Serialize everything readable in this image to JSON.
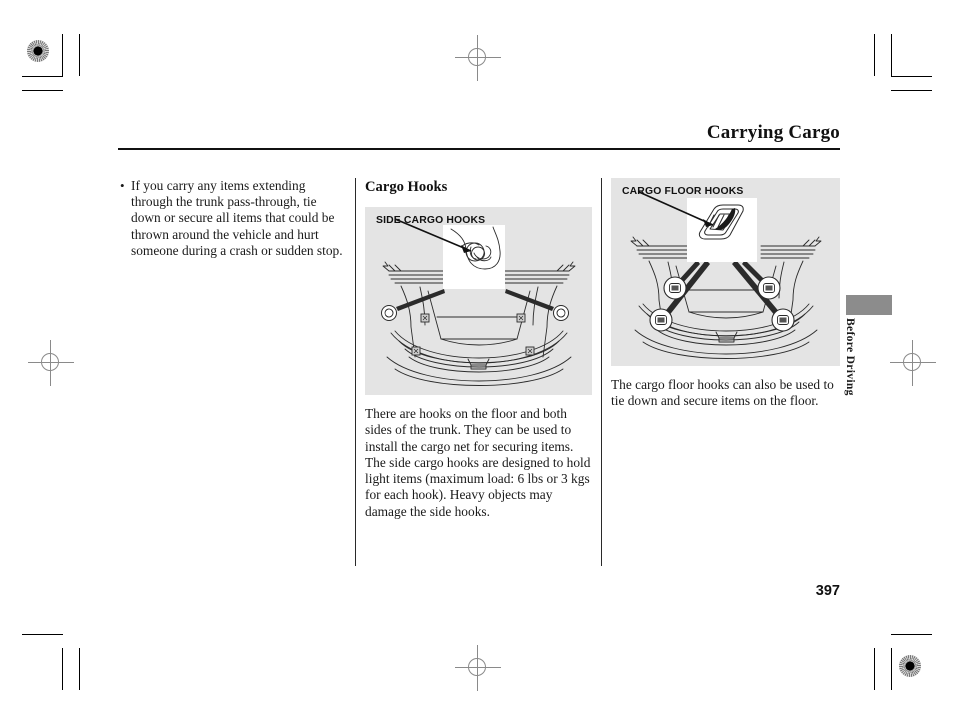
{
  "document": {
    "running_head": "Carrying Cargo",
    "page_number": "397",
    "thumb_tab": "Before Driving"
  },
  "columns": {
    "left": {
      "bullet_marker": "•",
      "bullet_text": "If you carry any items extending through the trunk pass-through, tie down or secure all items that could be thrown around the vehicle and hurt someone during a crash or sudden stop."
    },
    "middle": {
      "section_title": "Cargo Hooks",
      "figure_caption": "SIDE CARGO HOOKS",
      "body_text": "There are hooks on the floor and both sides of the trunk. They can be used to install the cargo net for securing items. The side cargo hooks are designed to hold light items (maximum load: 6 lbs or 3 kgs for each hook). Heavy objects may damage the side hooks."
    },
    "right": {
      "figure_caption": "CARGO FLOOR HOOKS",
      "body_text": "The cargo floor hooks can also be used to tie down and secure items on the floor."
    }
  },
  "figures": {
    "side_cargo_hooks": {
      "name": "trunk-interior-side-hooks-diagram",
      "description": "Rear view of an open trunk showing hook locations on both side walls, with a magnified inset of a single side cargo hook",
      "callout_count": 2,
      "floor_marker_count": 4
    },
    "cargo_floor_hooks": {
      "name": "trunk-interior-floor-hooks-diagram",
      "description": "Rear view of an open trunk showing four floor hook locations each magnified in a circular callout, with a rectangular inset of a recessed floor hook",
      "callout_count": 4
    }
  },
  "print_marks": {
    "registration_targets": 2,
    "crosshairs": 4,
    "colors": {
      "panel_background": "#e4e4e4",
      "thumb_tab": "#8c8c8c",
      "rule": "#111111"
    }
  }
}
